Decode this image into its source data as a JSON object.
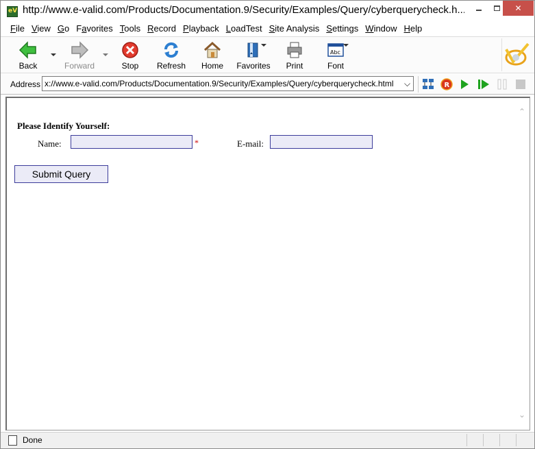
{
  "window": {
    "title": "http://www.e-valid.com/Products/Documentation.9/Security/Examples/Query/cyberquerycheck.h...",
    "close_glyph": "✕"
  },
  "menu": [
    "File",
    "View",
    "Go",
    "Favorites",
    "Tools",
    "Record",
    "Playback",
    "LoadTest",
    "Site Analysis",
    "Settings",
    "Window",
    "Help"
  ],
  "menu_underline": [
    "F",
    "V",
    "G",
    "a",
    "T",
    "R",
    "P",
    "L",
    "S",
    "S",
    "W",
    "H"
  ],
  "toolbar": {
    "back": "Back",
    "forward": "Forward",
    "stop": "Stop",
    "refresh": "Refresh",
    "home": "Home",
    "favorites": "Favorites",
    "print": "Print",
    "font": "Font"
  },
  "address": {
    "label": "Address",
    "value": "x://www.e-valid.com/Products/Documentation.9/Security/Examples/Query/cyberquerycheck.html",
    "dropdown_glyph": "⌵"
  },
  "form": {
    "title": "Please Identify Yourself:",
    "name_label": "Name:",
    "name_value": "",
    "required_mark": "*",
    "email_label": "E-mail:",
    "email_value": "",
    "submit_label": "Submit Query"
  },
  "status": {
    "text": "Done"
  },
  "colors": {
    "close_button": "#c7504a",
    "input_background": "#ebebf7",
    "input_border": "#3b3b9a",
    "required": "#cc0000"
  },
  "icons": [
    "app-icon",
    "back-arrow-icon",
    "forward-arrow-icon",
    "stop-icon",
    "refresh-icon",
    "home-icon",
    "favorites-book-icon",
    "print-icon",
    "font-icon",
    "evalid-logo-icon",
    "site-map-icon",
    "record-icon",
    "play-icon",
    "play-step-icon",
    "pause-icon",
    "stop-square-icon",
    "page-status-icon"
  ]
}
